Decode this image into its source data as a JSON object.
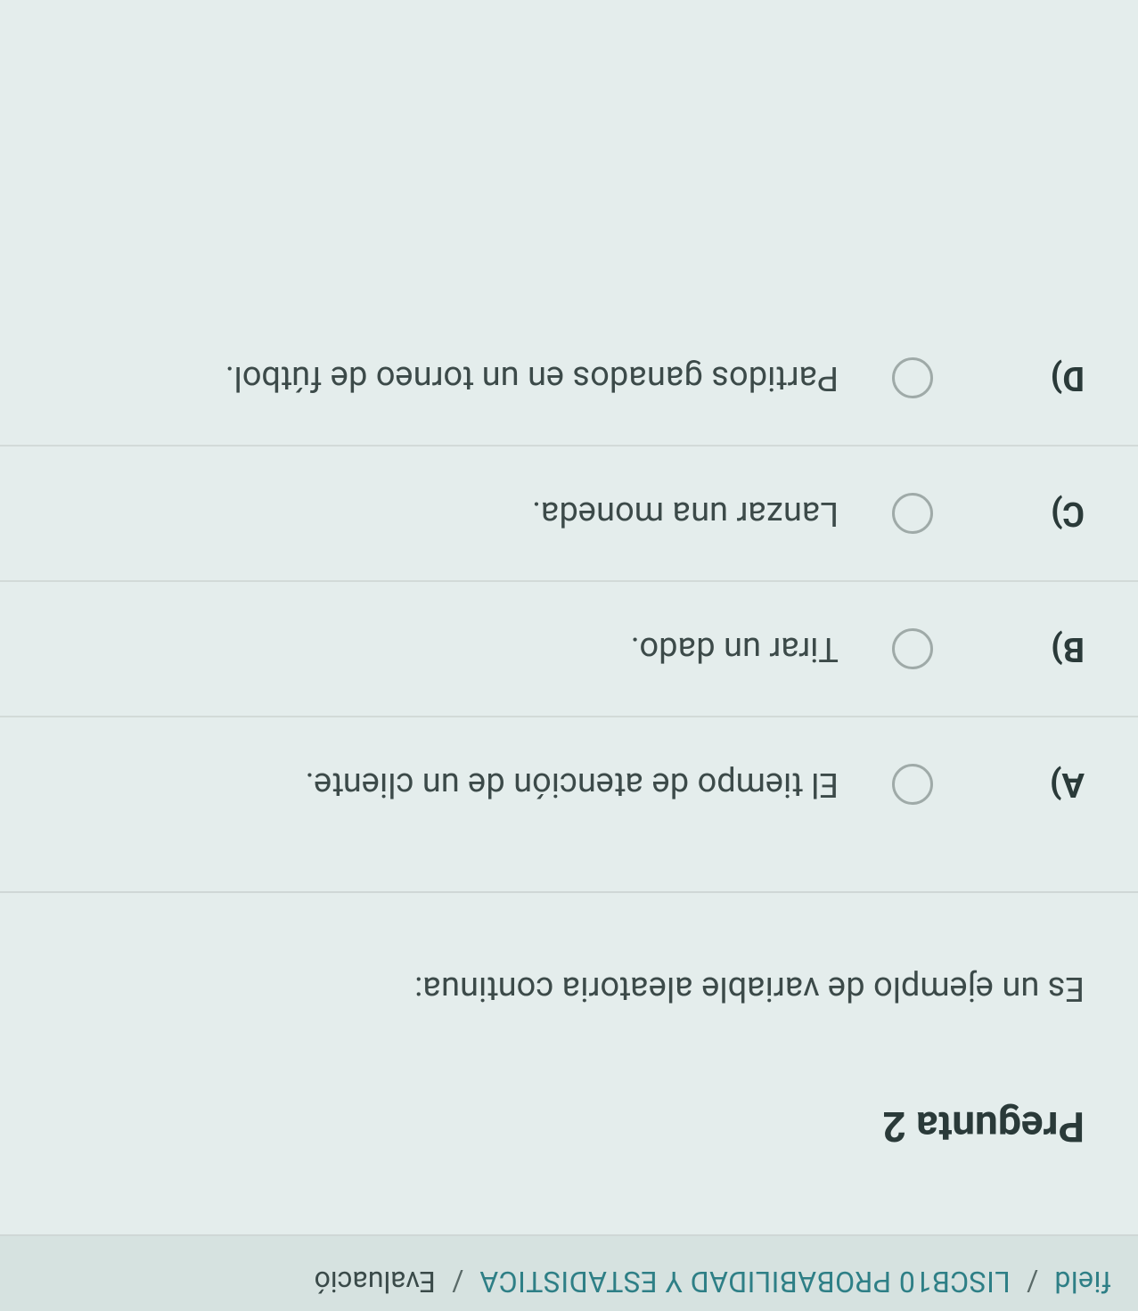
{
  "breadcrumb": {
    "part1": "field",
    "link": "LISCB10 PROBABILIDAD Y ESTADISTICA",
    "sep": "/",
    "current": "Evaluació"
  },
  "question": {
    "title": "Pregunta 2",
    "prompt": "Es un ejemplo de variable aleatoria continua:",
    "options": [
      {
        "letter": "A)",
        "text": "El tiempo de atención de un cliente."
      },
      {
        "letter": "B)",
        "text": "Tirar un dado."
      },
      {
        "letter": "C)",
        "text": "Lanzar una moneda."
      },
      {
        "letter": "D)",
        "text": "Partidos ganados en un torneo de fútbol."
      }
    ]
  }
}
